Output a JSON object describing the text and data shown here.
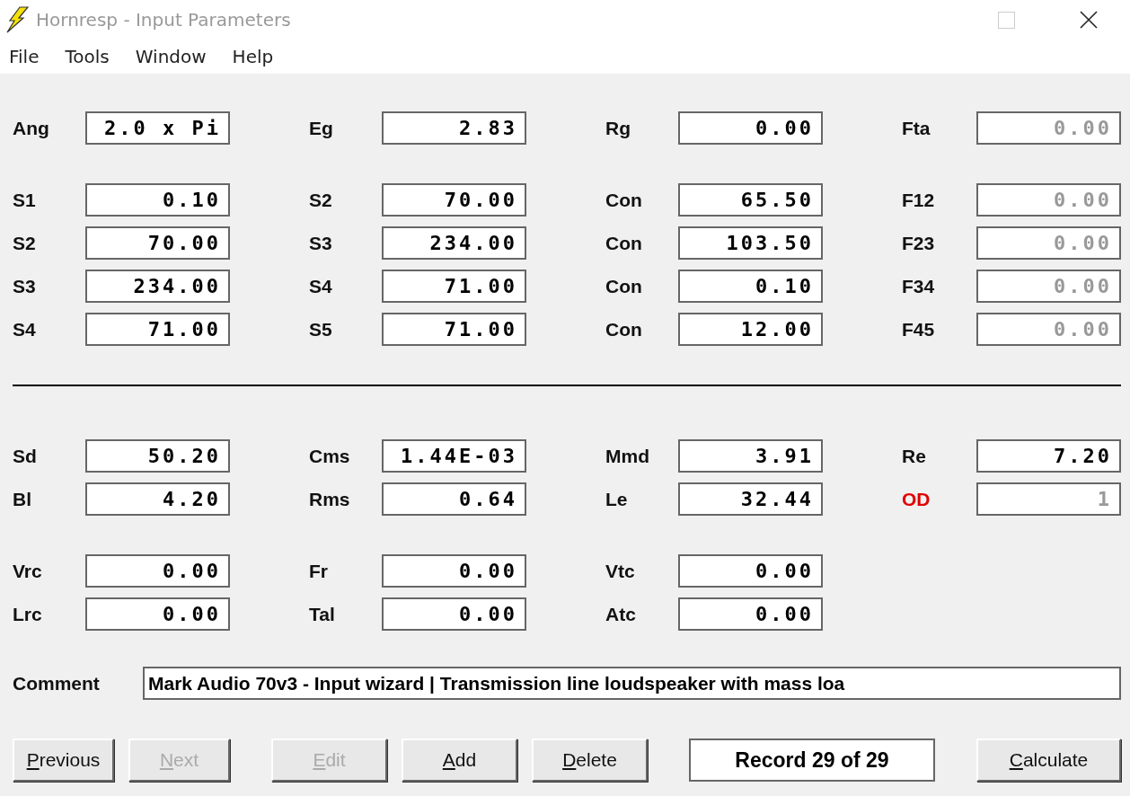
{
  "window": {
    "title": "Hornresp - Input Parameters"
  },
  "menu": [
    "File",
    "Tools",
    "Window",
    "Help"
  ],
  "sections": [
    {
      "kind": "fields",
      "rows": [
        [
          {
            "label": "Ang",
            "value": "2.0 x Pi",
            "disabled": false
          },
          {
            "label": "Eg",
            "value": "2.83",
            "disabled": false
          },
          {
            "label": "Rg",
            "value": "0.00",
            "disabled": false
          },
          {
            "label": "Fta",
            "value": "0.00",
            "disabled": true
          }
        ]
      ]
    },
    {
      "kind": "fields",
      "rows": [
        [
          {
            "label": "S1",
            "value": "0.10",
            "disabled": false
          },
          {
            "label": "S2",
            "value": "70.00",
            "disabled": false
          },
          {
            "label": "Con",
            "value": "65.50",
            "disabled": false
          },
          {
            "label": "F12",
            "value": "0.00",
            "disabled": true
          }
        ],
        [
          {
            "label": "S2",
            "value": "70.00",
            "disabled": false
          },
          {
            "label": "S3",
            "value": "234.00",
            "disabled": false
          },
          {
            "label": "Con",
            "value": "103.50",
            "disabled": false
          },
          {
            "label": "F23",
            "value": "0.00",
            "disabled": true
          }
        ],
        [
          {
            "label": "S3",
            "value": "234.00",
            "disabled": false
          },
          {
            "label": "S4",
            "value": "71.00",
            "disabled": false
          },
          {
            "label": "Con",
            "value": "0.10",
            "disabled": false
          },
          {
            "label": "F34",
            "value": "0.00",
            "disabled": true
          }
        ],
        [
          {
            "label": "S4",
            "value": "71.00",
            "disabled": false
          },
          {
            "label": "S5",
            "value": "71.00",
            "disabled": false
          },
          {
            "label": "Con",
            "value": "12.00",
            "disabled": false
          },
          {
            "label": "F45",
            "value": "0.00",
            "disabled": true
          }
        ]
      ]
    },
    {
      "kind": "divider"
    },
    {
      "kind": "fields",
      "rows": [
        [
          {
            "label": "Sd",
            "value": "50.20",
            "disabled": false
          },
          {
            "label": "Cms",
            "value": "1.44E-03",
            "disabled": false
          },
          {
            "label": "Mmd",
            "value": "3.91",
            "disabled": false
          },
          {
            "label": "Re",
            "value": "7.20",
            "disabled": false
          }
        ],
        [
          {
            "label": "Bl",
            "value": "4.20",
            "disabled": false
          },
          {
            "label": "Rms",
            "value": "0.64",
            "disabled": false
          },
          {
            "label": "Le",
            "value": "32.44",
            "disabled": false
          },
          {
            "label": "OD",
            "value": "1",
            "disabled": true,
            "warning": true
          }
        ]
      ]
    },
    {
      "kind": "fields",
      "rows": [
        [
          {
            "label": "Vrc",
            "value": "0.00",
            "disabled": false
          },
          {
            "label": "Fr",
            "value": "0.00",
            "disabled": false
          },
          {
            "label": "Vtc",
            "value": "0.00",
            "disabled": false
          }
        ],
        [
          {
            "label": "Lrc",
            "value": "0.00",
            "disabled": false
          },
          {
            "label": "Tal",
            "value": "0.00",
            "disabled": false
          },
          {
            "label": "Atc",
            "value": "0.00",
            "disabled": false
          }
        ]
      ]
    }
  ],
  "comment": {
    "label": "Comment",
    "value": "Mark Audio 70v3 - Input wizard | Transmission line loudspeaker with mass loa"
  },
  "buttons": [
    {
      "kind": "button",
      "label": "Previous",
      "disabled": false
    },
    {
      "kind": "button",
      "label": "Next",
      "disabled": true
    },
    {
      "kind": "gap"
    },
    {
      "kind": "button",
      "label": "Edit",
      "disabled": true
    },
    {
      "kind": "button",
      "label": "Add",
      "disabled": false
    },
    {
      "kind": "button",
      "label": "Delete",
      "disabled": false
    },
    {
      "kind": "record",
      "label": "Record 29 of 29"
    },
    {
      "kind": "button",
      "label": "Calculate",
      "disabled": false
    }
  ]
}
